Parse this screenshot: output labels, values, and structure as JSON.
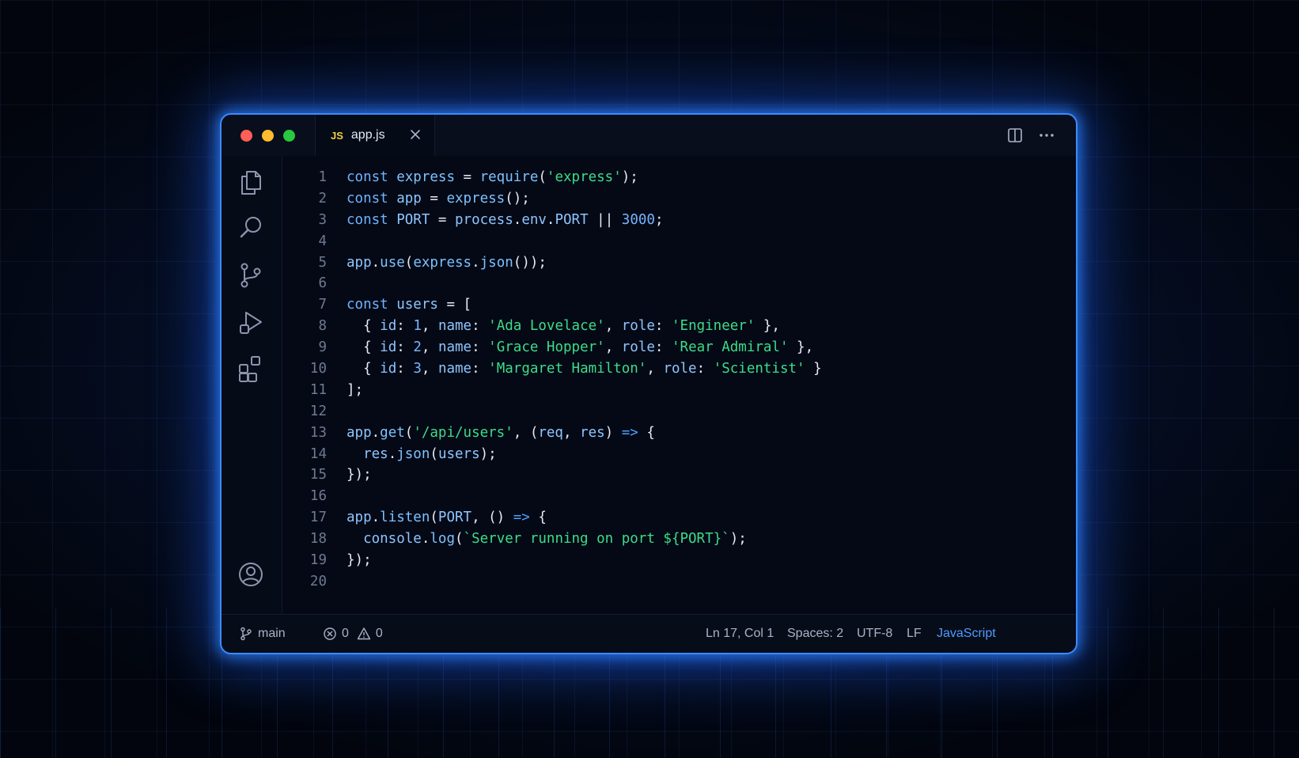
{
  "tab": {
    "badge": "JS",
    "filename": "app.js"
  },
  "icons": {
    "activity": [
      "files-icon",
      "search-icon",
      "source-control-icon",
      "run-debug-icon",
      "extensions-icon",
      "account-icon"
    ],
    "title_actions": [
      "split-editor-icon",
      "more-actions-icon"
    ]
  },
  "code": {
    "line_numbers": [
      "1",
      "2",
      "3",
      "4",
      "5",
      "6",
      "7",
      "8",
      "9",
      "10",
      "11",
      "12",
      "13",
      "14",
      "15",
      "16",
      "17",
      "18",
      "19",
      "20"
    ],
    "lines": [
      "const express = require('express');",
      "const app = express();",
      "const PORT = process.env.PORT || 3000;",
      "",
      "app.use(express.json());",
      "",
      "const users = [",
      "  { id: 1, name: 'Ada Lovelace', role: 'Engineer' },",
      "  { id: 2, name: 'Grace Hopper', role: 'Rear Admiral' },",
      "  { id: 3, name: 'Margaret Hamilton', role: 'Scientist' }",
      "];",
      "",
      "app.get('/api/users', (req, res) => {",
      "  res.json(users);",
      "});",
      "",
      "app.listen(PORT, () => {",
      "  console.log(`Server running on port ${PORT}`);",
      "});",
      ""
    ]
  },
  "status": {
    "branch": "main",
    "errors": "0",
    "warnings": "0",
    "cursor": "Ln 17, Col 1",
    "spaces": "Spaces: 2",
    "encoding": "UTF-8",
    "eol": "LF",
    "language": "JavaScript"
  },
  "colors": {
    "window_border": "#3d8bff",
    "keyword": "#6fb3ff",
    "string": "#3ddc8a",
    "language_accent": "#4e9bff",
    "close": "#ff5f57",
    "minimize": "#febc2e",
    "maximize": "#28c840"
  }
}
